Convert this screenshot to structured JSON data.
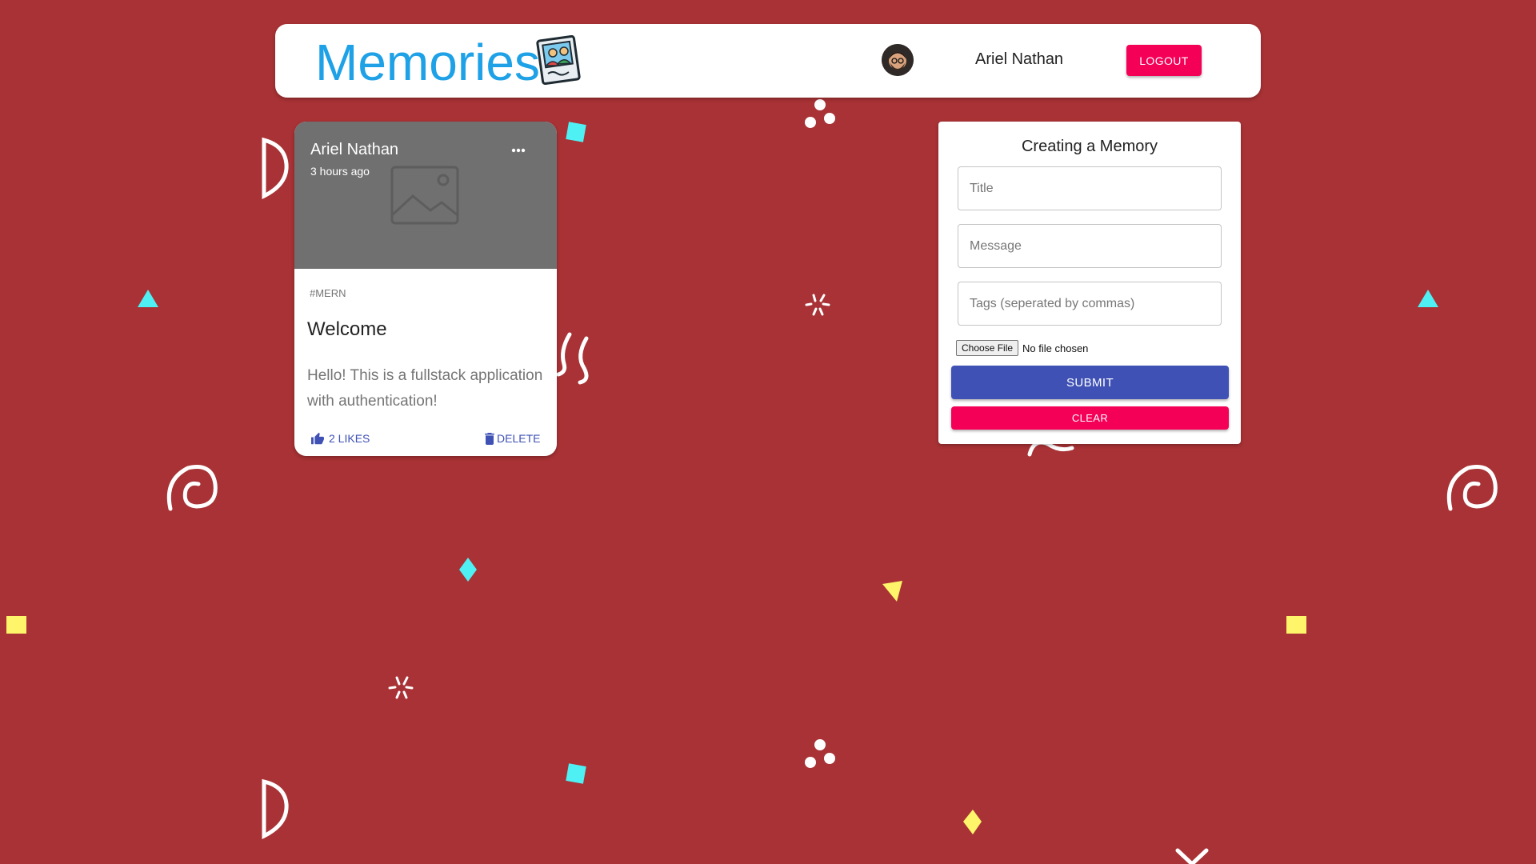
{
  "header": {
    "brand_title": "Memories",
    "user_name": "Ariel Nathan",
    "logout_label": "LOGOUT"
  },
  "posts": [
    {
      "creator": "Ariel Nathan",
      "time_ago": "3 hours ago",
      "tags": "#MERN",
      "title": "Welcome",
      "message": "Hello! This is a fullstack application with authentication!",
      "like_label": "2 LIKES",
      "delete_label": "DELETE",
      "more_icon": "more-horiz-icon"
    }
  ],
  "form": {
    "heading": "Creating a Memory",
    "title_placeholder": "Title",
    "message_placeholder": "Message",
    "tags_placeholder": "Tags (seperated by commas)",
    "choose_file_label": "Choose File",
    "file_status": "No file chosen",
    "submit_label": "SUBMIT",
    "clear_label": "CLEAR"
  },
  "colors": {
    "background": "#a83235",
    "brand": "#1ea1e6",
    "primary": "#3f51b5",
    "secondary": "#f50057"
  }
}
